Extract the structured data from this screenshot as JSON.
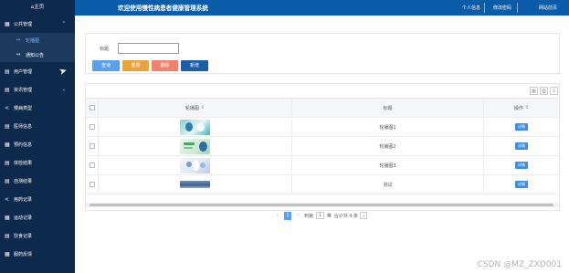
{
  "sidebar": {
    "home_label": "⌂主页",
    "items": [
      {
        "icon": "grid-icon",
        "glyph": "▦",
        "label": "公共管理",
        "chevron": "⌃"
      },
      {
        "icon": "link-icon",
        "glyph": "↔",
        "label": "轮播图",
        "sub": true,
        "active": true
      },
      {
        "icon": "link-icon",
        "glyph": "↔",
        "label": "通知公告",
        "sub": true
      },
      {
        "icon": "table-icon",
        "glyph": "▤",
        "label": "用户管理",
        "chevron": "⌄"
      },
      {
        "icon": "table-icon",
        "glyph": "▤",
        "label": "资讯管理",
        "chevron": "⌄"
      },
      {
        "icon": "share-icon",
        "glyph": "<",
        "label": "慢病类型"
      },
      {
        "icon": "table-icon",
        "glyph": "▤",
        "label": "医师信息"
      },
      {
        "icon": "grid-icon",
        "glyph": "▦",
        "label": "预约信息"
      },
      {
        "icon": "table-icon",
        "glyph": "▤",
        "label": "体检结果"
      },
      {
        "icon": "table-icon",
        "glyph": "▤",
        "label": "自测结果"
      },
      {
        "icon": "share-icon",
        "glyph": "<",
        "label": "用药记录"
      },
      {
        "icon": "grid-icon",
        "glyph": "▦",
        "label": "运动记录"
      },
      {
        "icon": "table-icon",
        "glyph": "▤",
        "label": "饮食记录"
      },
      {
        "icon": "grid-icon",
        "glyph": "▦",
        "label": "服药反馈"
      }
    ]
  },
  "header": {
    "title": "欢迎使用慢性病患者健康管理系统",
    "links": [
      "个人信息",
      "修改密码",
      "网站前页"
    ]
  },
  "search": {
    "label": "标题",
    "value": "",
    "placeholder": "",
    "buttons": {
      "query": "查询",
      "reset": "重置",
      "delete": "删除",
      "add": "新增"
    }
  },
  "table": {
    "toolbar_icons": [
      "columns-icon",
      "print-icon",
      "export-icon"
    ],
    "columns": [
      "轮播图",
      "标题",
      "操作"
    ],
    "rows": [
      {
        "title": "轮播图1",
        "action": "详情"
      },
      {
        "title": "轮播图2",
        "action": "详情"
      },
      {
        "title": "轮播图3",
        "action": "详情"
      },
      {
        "title": "测试",
        "action": "详情"
      }
    ]
  },
  "pagination": {
    "prev": "‹",
    "current_page": "1",
    "next": "›",
    "goto_label": "到第",
    "goto_value": "1",
    "total_text": "合计共 4 条",
    "page_size_arrow": "⌄"
  },
  "watermark": "CSDN @MZ_ZXD001",
  "colors": {
    "sidebar": "#0d2a4d",
    "header": "#0a5ba8",
    "query": "#5aa0ee",
    "reset": "#e9a33a",
    "delete": "#f0826b",
    "add": "#1a5fa8",
    "detail": "#3e8ee4"
  }
}
